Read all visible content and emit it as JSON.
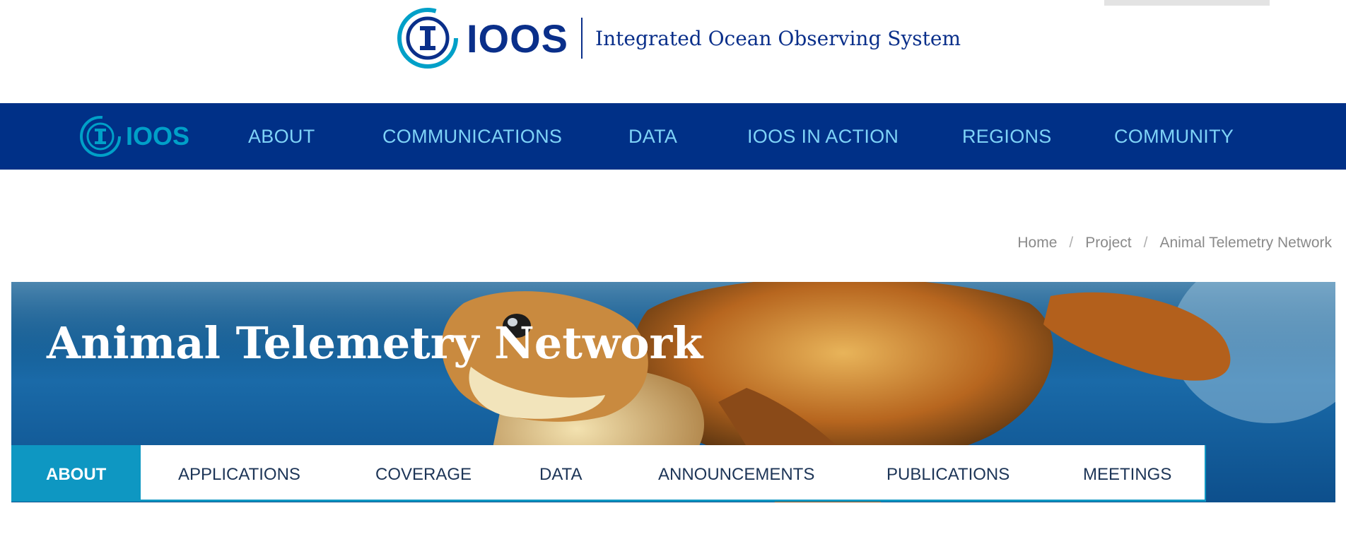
{
  "brand": {
    "logo_word": "IOOS",
    "tagline": "Integrated Ocean Observing System"
  },
  "nav": {
    "logo_word": "IOOS",
    "items": [
      "ABOUT",
      "COMMUNICATIONS",
      "DATA",
      "IOOS IN ACTION",
      "REGIONS",
      "COMMUNITY"
    ]
  },
  "breadcrumb": [
    "Home",
    "Project",
    "Animal Telemetry Network"
  ],
  "hero": {
    "title": "Animal Telemetry Network"
  },
  "tabs": [
    "ABOUT",
    "APPLICATIONS",
    "COVERAGE",
    "DATA",
    "ANNOUNCEMENTS",
    "PUBLICATIONS",
    "MEETINGS"
  ],
  "colors": {
    "nav_bg": "#003087",
    "accent": "#0e97c2",
    "nav_text": "#7fd3f7"
  }
}
